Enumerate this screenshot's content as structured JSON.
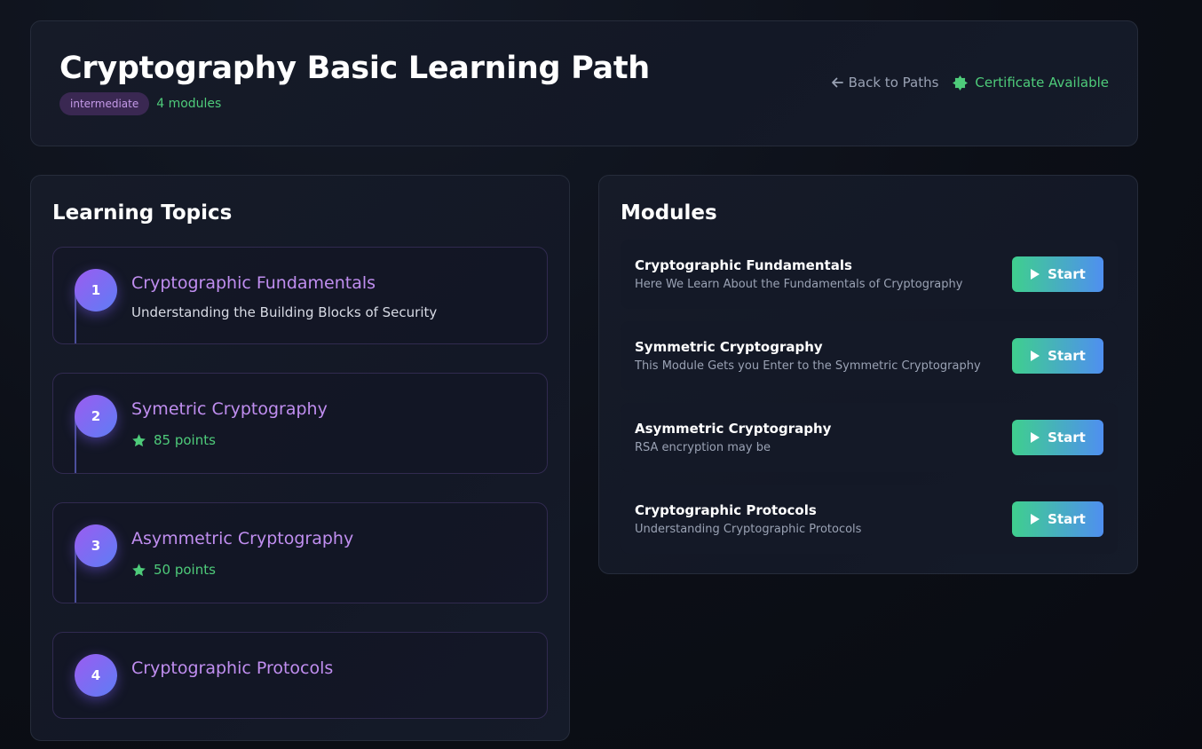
{
  "header": {
    "title": "Cryptography Basic Learning Path",
    "level": "intermediate",
    "module_count": "4 modules",
    "back_label": "Back to Paths",
    "certificate_label": "Certificate Available"
  },
  "topics": {
    "title": "Learning Topics",
    "items": [
      {
        "number": "1",
        "title": "Cryptographic Fundamentals",
        "subtitle": "Understanding the Building Blocks of Security"
      },
      {
        "number": "2",
        "title": "Symetric Cryptography",
        "points": "85 points"
      },
      {
        "number": "3",
        "title": "Asymmetric Cryptography",
        "points": "50 points"
      },
      {
        "number": "4",
        "title": "Cryptographic Protocols"
      }
    ]
  },
  "modules": {
    "title": "Modules",
    "items": [
      {
        "title": "Cryptographic Fundamentals",
        "description": "Here We Learn About the Fundamentals of Cryptography",
        "button": "Start"
      },
      {
        "title": "Symmetric Cryptography",
        "description": "This Module Gets you Enter to the Symmetric Cryptography",
        "button": "Start"
      },
      {
        "title": "Asymmetric Cryptography",
        "description": "RSA encryption may be",
        "button": "Start"
      },
      {
        "title": "Cryptographic Protocols",
        "description": "Understanding Cryptographic Protocols",
        "button": "Start"
      }
    ]
  },
  "colors": {
    "accent_green": "#4ecb7a",
    "accent_purple": "#c08ef0",
    "button_gradient_start": "#3fcf8e",
    "button_gradient_end": "#4f8ff0"
  },
  "icons": {
    "back": "arrow-left-icon",
    "certificate": "certificate-seal-icon",
    "points": "star-icon",
    "start": "play-icon"
  }
}
